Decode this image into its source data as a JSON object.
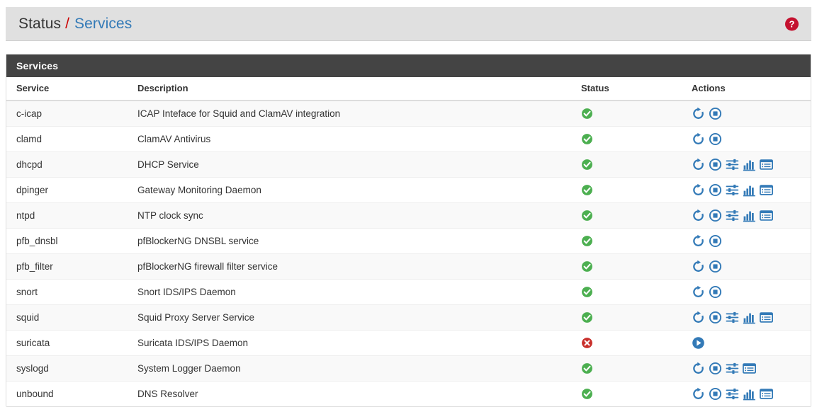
{
  "breadcrumb": {
    "root": "Status",
    "separator": "/",
    "current": "Services",
    "help_icon": "help-circle-icon"
  },
  "colors": {
    "link": "#337ab7",
    "separator": "#cc0000",
    "panel_heading_bg": "#444444",
    "header_bar_bg": "#e0e0e0",
    "status_running": "#4caf50",
    "status_stopped": "#c9302c",
    "action_icon": "#337ab7",
    "row_stripe": "#f9f9f9"
  },
  "panel": {
    "title": "Services"
  },
  "table": {
    "columns": [
      "Service",
      "Description",
      "Status",
      "Actions"
    ],
    "rows": [
      {
        "service": "c-icap",
        "description": "ICAP Inteface for Squid and ClamAV integration",
        "status": "running",
        "status_icon": "check-circle-icon",
        "actions": [
          "restart-icon",
          "stop-icon"
        ]
      },
      {
        "service": "clamd",
        "description": "ClamAV Antivirus",
        "status": "running",
        "status_icon": "check-circle-icon",
        "actions": [
          "restart-icon",
          "stop-icon"
        ]
      },
      {
        "service": "dhcpd",
        "description": "DHCP Service",
        "status": "running",
        "status_icon": "check-circle-icon",
        "actions": [
          "restart-icon",
          "stop-icon",
          "settings-sliders-icon",
          "bar-chart-icon",
          "log-list-icon"
        ]
      },
      {
        "service": "dpinger",
        "description": "Gateway Monitoring Daemon",
        "status": "running",
        "status_icon": "check-circle-icon",
        "actions": [
          "restart-icon",
          "stop-icon",
          "settings-sliders-icon",
          "bar-chart-icon",
          "log-list-icon"
        ]
      },
      {
        "service": "ntpd",
        "description": "NTP clock sync",
        "status": "running",
        "status_icon": "check-circle-icon",
        "actions": [
          "restart-icon",
          "stop-icon",
          "settings-sliders-icon",
          "bar-chart-icon",
          "log-list-icon"
        ]
      },
      {
        "service": "pfb_dnsbl",
        "description": "pfBlockerNG DNSBL service",
        "status": "running",
        "status_icon": "check-circle-icon",
        "actions": [
          "restart-icon",
          "stop-icon"
        ]
      },
      {
        "service": "pfb_filter",
        "description": "pfBlockerNG firewall filter service",
        "status": "running",
        "status_icon": "check-circle-icon",
        "actions": [
          "restart-icon",
          "stop-icon"
        ]
      },
      {
        "service": "snort",
        "description": "Snort IDS/IPS Daemon",
        "status": "running",
        "status_icon": "check-circle-icon",
        "actions": [
          "restart-icon",
          "stop-icon"
        ]
      },
      {
        "service": "squid",
        "description": "Squid Proxy Server Service",
        "status": "running",
        "status_icon": "check-circle-icon",
        "actions": [
          "restart-icon",
          "stop-icon",
          "settings-sliders-icon",
          "bar-chart-icon",
          "log-list-icon"
        ]
      },
      {
        "service": "suricata",
        "description": "Suricata IDS/IPS Daemon",
        "status": "stopped",
        "status_icon": "times-circle-icon",
        "actions": [
          "start-icon"
        ]
      },
      {
        "service": "syslogd",
        "description": "System Logger Daemon",
        "status": "running",
        "status_icon": "check-circle-icon",
        "actions": [
          "restart-icon",
          "stop-icon",
          "settings-sliders-icon",
          "log-list-icon"
        ]
      },
      {
        "service": "unbound",
        "description": "DNS Resolver",
        "status": "running",
        "status_icon": "check-circle-icon",
        "actions": [
          "restart-icon",
          "stop-icon",
          "settings-sliders-icon",
          "bar-chart-icon",
          "log-list-icon"
        ]
      }
    ]
  }
}
